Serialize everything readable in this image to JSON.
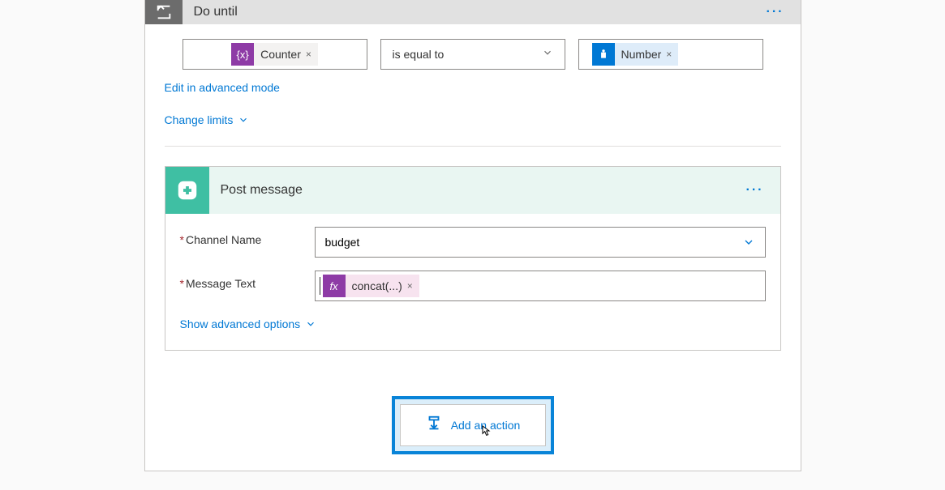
{
  "doUntil": {
    "title": "Do until",
    "token1": {
      "label": "Counter",
      "iconText": "{x}"
    },
    "operator": "is equal to",
    "token2": {
      "label": "Number"
    },
    "editAdvanced": "Edit in advanced mode",
    "changeLimits": "Change limits"
  },
  "postMessage": {
    "title": "Post message",
    "channelLabel": "Channel Name",
    "channelValue": "budget",
    "messageLabel": "Message Text",
    "messageToken": {
      "label": "concat(...)",
      "iconText": "fx"
    },
    "showAdvanced": "Show advanced options"
  },
  "addAction": {
    "label": "Add an action"
  },
  "colors": {
    "primary": "#0078d4",
    "slack": "#3fbfa3",
    "variable": "#8e3ba6"
  }
}
